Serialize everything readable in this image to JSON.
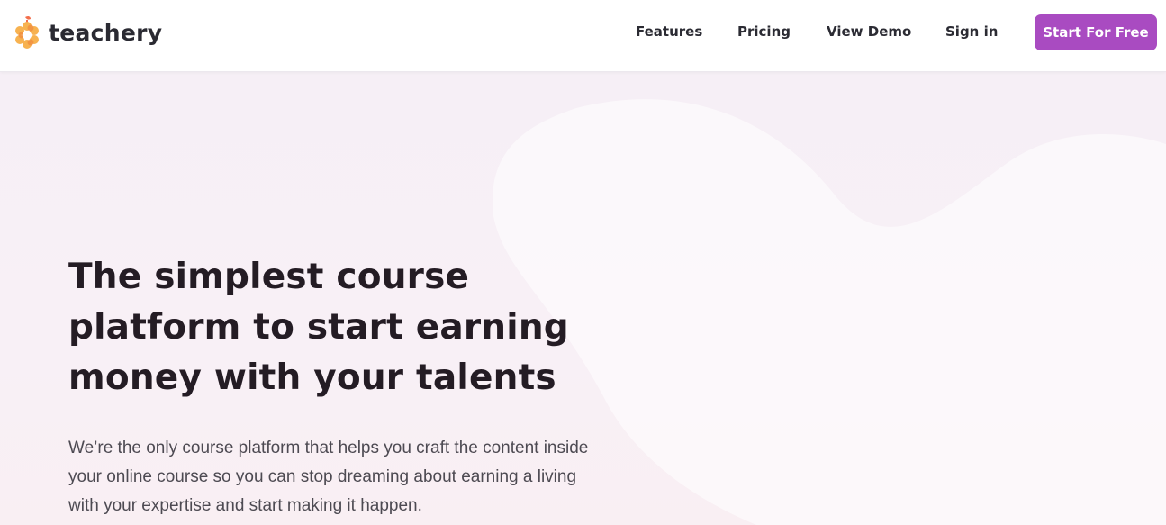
{
  "brand": {
    "name": "teachery",
    "icon": "orange-flower-logo-icon",
    "colors": {
      "petal": "#f7b250",
      "petal_dark": "#f08a3c",
      "leaf": "#f36e4b"
    }
  },
  "nav": {
    "items": [
      {
        "label": "Features"
      },
      {
        "label": "Pricing"
      },
      {
        "label": "View Demo"
      },
      {
        "label": "Sign in"
      }
    ],
    "cta_label": "Start For Free"
  },
  "hero": {
    "title": "The simplest course platform to start earning money with your talents",
    "description": "We’re the only course platform that helps you craft the content inside your online course so you can stop dreaming about earning a living with your expertise and start making it happen."
  },
  "colors": {
    "accent": "#a94bc1",
    "hero_background": "#f6eff6",
    "heading": "#241c24",
    "body_text": "#4d4a52"
  }
}
